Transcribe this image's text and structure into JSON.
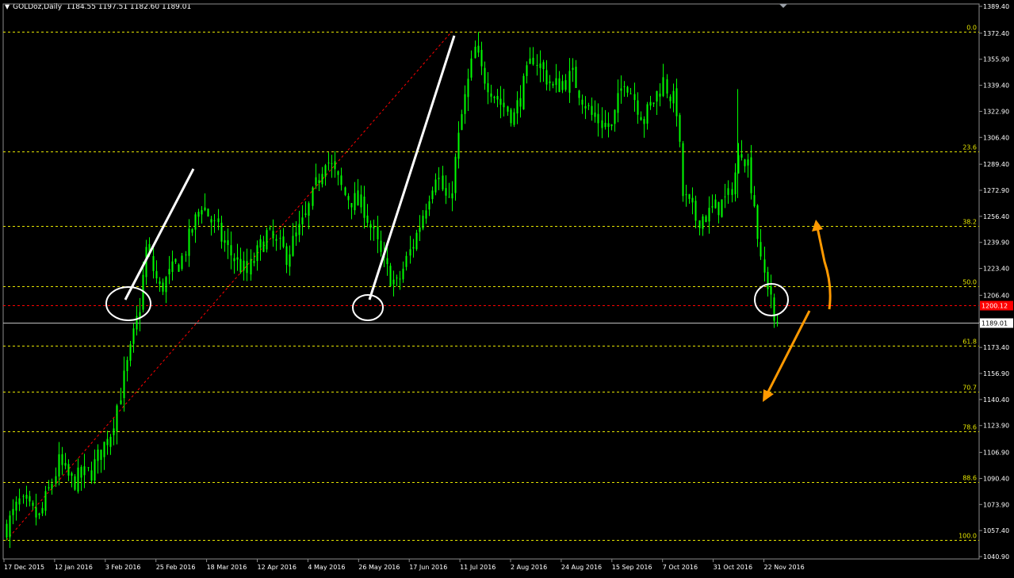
{
  "header": {
    "symbol": "GOLDoz,Daily",
    "ohlc": "1184.55 1197.51 1182.60 1189.01"
  },
  "colors": {
    "background": "#000000",
    "candle": "#00ff00",
    "fib_line": "#e6e600",
    "fib_label": "#e6e600",
    "axis_text": "#ffffff",
    "red_level": "#ff0000",
    "bid_line": "#c0c0c0",
    "trend_lines": "#ffffff",
    "arrows": "#ff9900",
    "diagonal": "#ff0000"
  },
  "chart_data": {
    "type": "candlestick",
    "y_axis": {
      "min": 1040.9,
      "max": 1389.4,
      "ticks": [
        "1389.40",
        "1372.40",
        "1355.90",
        "1339.40",
        "1322.90",
        "1306.40",
        "1289.40",
        "1272.90",
        "1256.40",
        "1239.90",
        "1223.40",
        "1206.40",
        "1189.40",
        "1173.40",
        "1156.90",
        "1140.40",
        "1123.90",
        "1106.90",
        "1090.40",
        "1073.90",
        "1057.40",
        "1040.90"
      ]
    },
    "x_axis": {
      "labels": [
        "17 Dec 2015",
        "12 Jan 2016",
        "3 Feb 2016",
        "25 Feb 2016",
        "18 Mar 2016",
        "12 Apr 2016",
        "4 May 2016",
        "26 May 2016",
        "17 Jun 2016",
        "11 Jul 2016",
        "2 Aug 2016",
        "24 Aug 2016",
        "15 Sep 2016",
        "7 Oct 2016",
        "31 Oct 2016",
        "22 Nov 2016"
      ],
      "sessions_total": 238
    },
    "fib_levels": [
      {
        "label": "0.0",
        "price": 1373.5
      },
      {
        "label": "23.6",
        "price": 1297.5
      },
      {
        "label": "38.2",
        "price": 1250.5
      },
      {
        "label": "50.0",
        "price": 1212.3
      },
      {
        "label": "61.8",
        "price": 1174.3
      },
      {
        "label": "70.7",
        "price": 1145.5
      },
      {
        "label": "78.6",
        "price": 1120.2
      },
      {
        "label": "88.6",
        "price": 1088.0
      },
      {
        "label": "100.0",
        "price": 1051.2
      }
    ],
    "red_level": {
      "label": "1200.12",
      "price": 1200.12
    },
    "current_price": {
      "label": "1189.01",
      "price": 1189.01
    },
    "price_anchors": [
      {
        "session": 0,
        "price": 1060
      },
      {
        "session": 4,
        "price": 1075
      },
      {
        "session": 10,
        "price": 1065
      },
      {
        "session": 16,
        "price": 1100
      },
      {
        "session": 20,
        "price": 1088
      },
      {
        "session": 26,
        "price": 1095
      },
      {
        "session": 32,
        "price": 1120
      },
      {
        "session": 38,
        "price": 1170
      },
      {
        "session": 41,
        "price": 1200
      },
      {
        "session": 43,
        "price": 1235
      },
      {
        "session": 47,
        "price": 1210
      },
      {
        "session": 54,
        "price": 1230
      },
      {
        "session": 60,
        "price": 1265
      },
      {
        "session": 64,
        "price": 1250
      },
      {
        "session": 68,
        "price": 1235
      },
      {
        "session": 74,
        "price": 1220
      },
      {
        "session": 80,
        "price": 1245
      },
      {
        "session": 86,
        "price": 1232
      },
      {
        "session": 92,
        "price": 1255
      },
      {
        "session": 98,
        "price": 1295
      },
      {
        "session": 104,
        "price": 1270
      },
      {
        "session": 110,
        "price": 1262
      },
      {
        "session": 116,
        "price": 1225
      },
      {
        "session": 120,
        "price": 1212
      },
      {
        "session": 126,
        "price": 1245
      },
      {
        "session": 132,
        "price": 1285
      },
      {
        "session": 136,
        "price": 1262
      },
      {
        "session": 140,
        "price": 1320
      },
      {
        "session": 144,
        "price": 1362
      },
      {
        "session": 146,
        "price": 1348
      },
      {
        "session": 152,
        "price": 1328
      },
      {
        "session": 156,
        "price": 1320
      },
      {
        "session": 162,
        "price": 1358
      },
      {
        "session": 168,
        "price": 1338
      },
      {
        "session": 174,
        "price": 1345
      },
      {
        "session": 180,
        "price": 1320
      },
      {
        "session": 186,
        "price": 1312
      },
      {
        "session": 190,
        "price": 1345
      },
      {
        "session": 196,
        "price": 1318
      },
      {
        "session": 202,
        "price": 1342
      },
      {
        "session": 206,
        "price": 1325
      },
      {
        "session": 208,
        "price": 1270
      },
      {
        "session": 212,
        "price": 1255
      },
      {
        "session": 216,
        "price": 1258
      },
      {
        "session": 222,
        "price": 1268
      },
      {
        "session": 226,
        "price": 1300
      },
      {
        "session": 228,
        "price": 1290
      },
      {
        "session": 230,
        "price": 1265
      },
      {
        "session": 232,
        "price": 1225
      },
      {
        "session": 235,
        "price": 1208
      },
      {
        "session": 236,
        "price": 1185
      },
      {
        "session": 237,
        "price": 1189
      }
    ]
  }
}
